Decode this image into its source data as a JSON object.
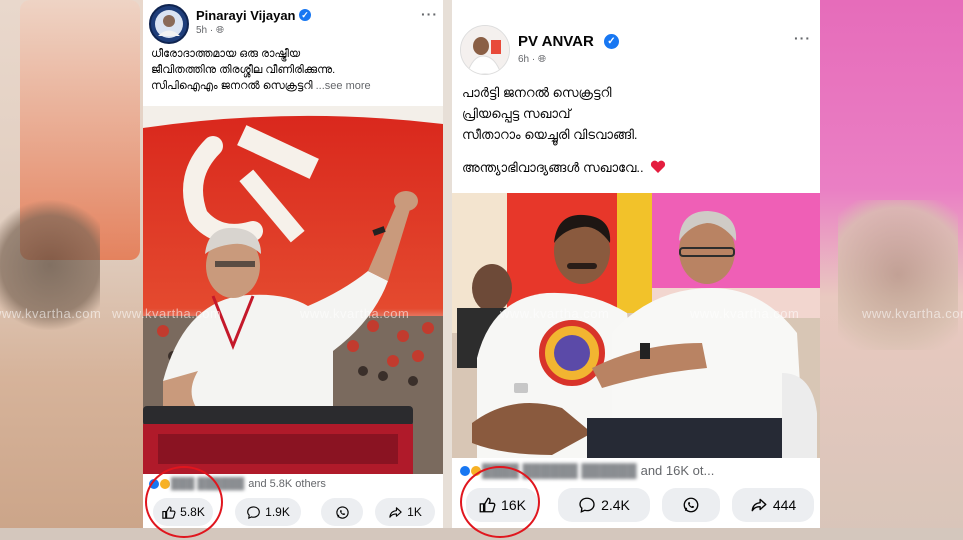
{
  "watermark": "www.kvartha.com",
  "posts": [
    {
      "author": "Pinarayi Vijayan",
      "time": "5h",
      "caption": [
        "ധീരോദാത്തമായ ഒരു രാഷ്ട്രീയ",
        "ജീവിതത്തിനു തിരശ്ശീല വീണിരിക്കുന്നു.",
        "സിപിഐഎം ജനറൽ സെക്രട്ടറി"
      ],
      "see_more": "...see more",
      "reactions_text": "and 5.8K others",
      "likes": "5.8K",
      "comments": "1.9K",
      "shares": "1K"
    },
    {
      "author": "PV ANVAR",
      "time": "6h",
      "caption": [
        "പാർട്ടി ജനറൽ സെക്രട്ടറി",
        "പ്രിയപ്പെട്ട സഖാവ്",
        "സീതാറാം യെച്ചൂരി വിടവാങ്ങി.",
        "",
        "അന്ത്യാഭിവാദ്യങ്ങൾ സഖാവേ.."
      ],
      "reactions_text": "and 16K ot...",
      "likes": "16K",
      "comments": "2.4K",
      "shares": "444"
    }
  ],
  "icons": {
    "like": "thumbs-up-icon",
    "comment": "comment-icon",
    "whatsapp": "whatsapp-icon",
    "share": "share-icon",
    "heart": "heart-icon"
  },
  "colors": {
    "facebook_blue": "#1877f2",
    "highlight_ring": "#e0161e",
    "heart": "#e41e3f",
    "party_red": "#d9261c"
  }
}
